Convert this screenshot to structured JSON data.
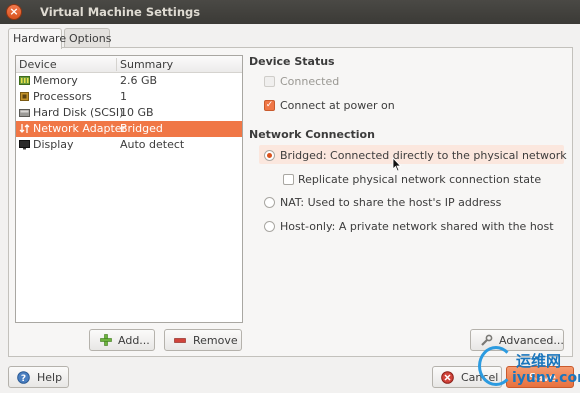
{
  "window": {
    "title": "Virtual Machine Settings"
  },
  "tabs": [
    {
      "label": "Hardware",
      "active": true
    },
    {
      "label": "Options",
      "active": false
    }
  ],
  "device_table": {
    "headers": {
      "device": "Device",
      "summary": "Summary"
    },
    "rows": [
      {
        "device": "Memory",
        "summary": "2.6 GB",
        "icon": "memory-icon"
      },
      {
        "device": "Processors",
        "summary": "1",
        "icon": "processor-icon"
      },
      {
        "device": "Hard Disk (SCSI)",
        "summary": "10 GB",
        "icon": "hard-disk-icon"
      },
      {
        "device": "Network Adapter",
        "summary": "Bridged",
        "icon": "network-adapter-icon",
        "selected": true
      },
      {
        "device": "Display",
        "summary": "Auto detect",
        "icon": "display-icon"
      }
    ]
  },
  "buttons": {
    "add": "Add...",
    "remove": "Remove",
    "advanced": "Advanced...",
    "help": "Help",
    "cancel": "Cancel",
    "save": "Save"
  },
  "device_status": {
    "title": "Device Status",
    "connected": {
      "label": "Connected",
      "checked": false,
      "disabled": true
    },
    "connect_at_power_on": {
      "label": "Connect at power on",
      "checked": true
    }
  },
  "network_connection": {
    "title": "Network Connection",
    "bridged": {
      "label": "Bridged: Connected directly to the physical network",
      "selected": true
    },
    "replicate": {
      "label": "Replicate physical network connection state",
      "checked": false
    },
    "nat": {
      "label": "NAT: Used to share the host's IP address",
      "selected": false
    },
    "host_only": {
      "label": "Host-only: A private network shared with the host",
      "selected": false
    }
  },
  "watermark": {
    "line1": "运维网",
    "line2": "iyunv.com"
  },
  "colors": {
    "accent": "#f07746",
    "titlebar": "#3c3b37",
    "window_bg": "#f2f1f0"
  }
}
